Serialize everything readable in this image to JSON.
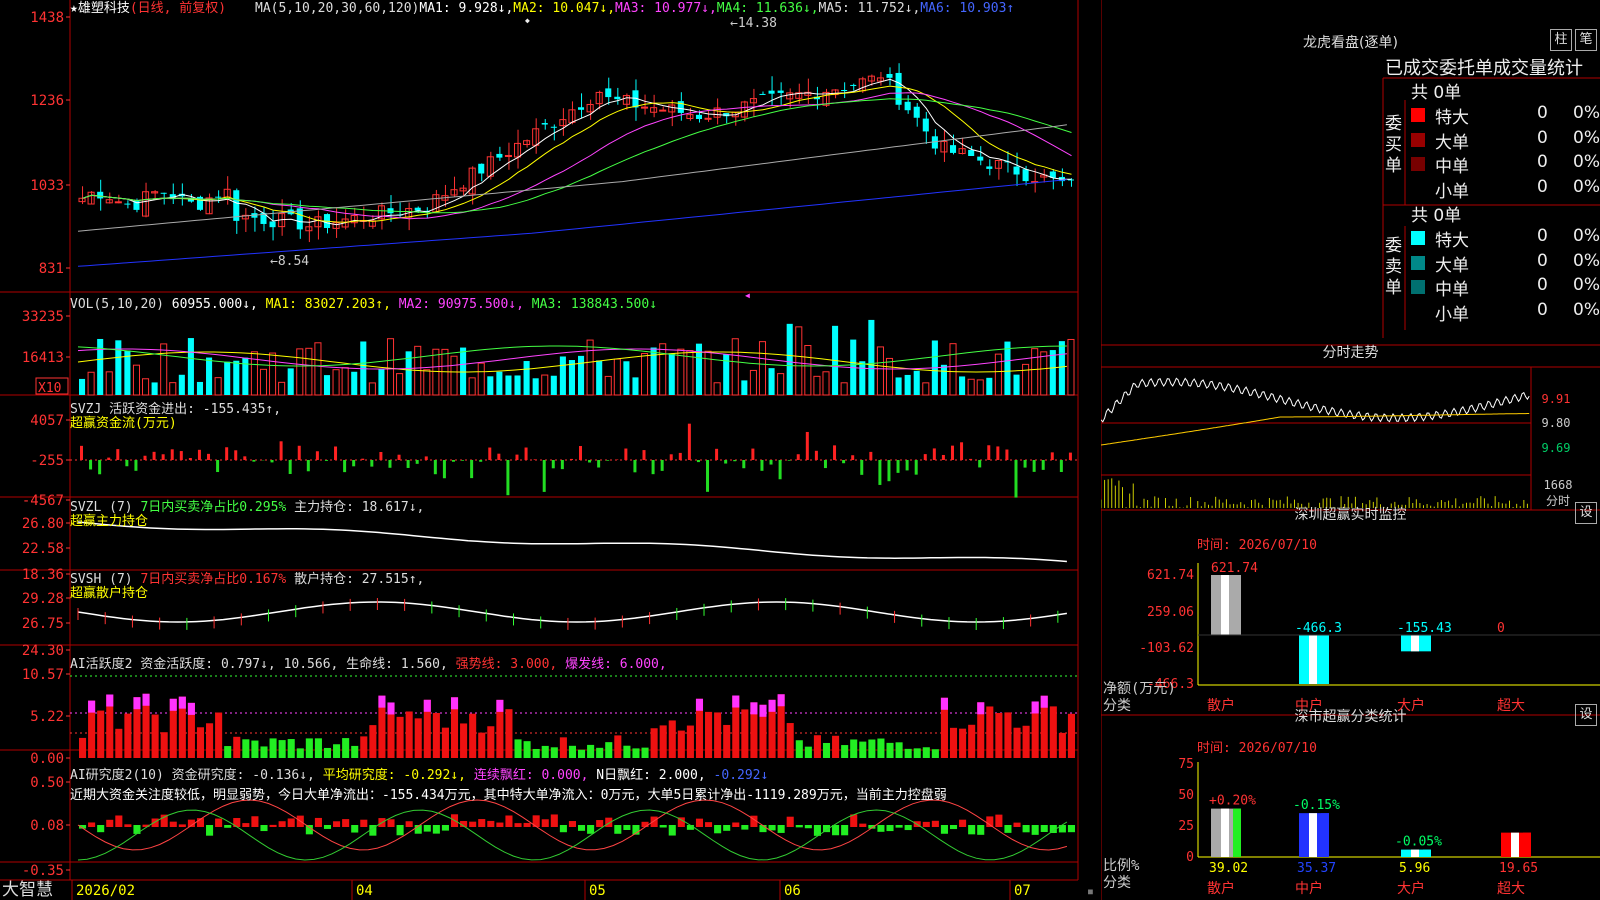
{
  "stock": {
    "name": "雄塑科技",
    "mode": "(日线, 前复权)",
    "ma_line": [
      {
        "label": "MA(5,10,20,30,60,120)",
        "color": "#dddddd"
      },
      {
        "label": "MA1: 9.928↓,",
        "color": "#ffffff"
      },
      {
        "label": "MA2: 10.047↓,",
        "color": "#ffff00"
      },
      {
        "label": "MA3: 10.977↓,",
        "color": "#ff44ff"
      },
      {
        "label": "MA4: 11.636↓,",
        "color": "#44ff44"
      },
      {
        "label": "MA5: 11.752↓,",
        "color": "#dddddd"
      },
      {
        "label": "MA6: 10.903↑",
        "color": "#4466ff"
      }
    ],
    "high_mark": "14.38",
    "low_mark": "8.54"
  },
  "axes": {
    "price": [
      "1438",
      "1236",
      "1033",
      "831"
    ],
    "vol": [
      "33235",
      "16413"
    ],
    "vol_unit": "X10",
    "svzj": [
      "4057",
      "-255",
      "-4567"
    ],
    "svzl": [
      "26.80",
      "22.58",
      "18.36"
    ],
    "svsh": [
      "29.28",
      "26.75",
      "24.30"
    ],
    "ai1": [
      "10.57",
      "5.22",
      "0.00"
    ],
    "ai2": [
      "0.50",
      "0.08",
      "-0.35"
    ],
    "dates": [
      "2026/02",
      "04",
      "05",
      "06",
      "07"
    ]
  },
  "indicators": {
    "vol": [
      {
        "label": "VOL(5,10,20)",
        "color": "#dddddd"
      },
      {
        "label": " 60955.000↓,",
        "color": "#ffffff"
      },
      {
        "label": " MA1: 83027.203↑,",
        "color": "#ffff00"
      },
      {
        "label": " MA2: 90975.500↓,",
        "color": "#ff44ff"
      },
      {
        "label": " MA3: 138843.500↓",
        "color": "#44ff44"
      }
    ],
    "svzj": [
      {
        "label": "SVZJ  活跃资金进出: -155.435↑,",
        "color": "#dddddd"
      }
    ],
    "svzj_sub": "超赢资金流(万元)",
    "svzl": [
      {
        "label": "SVZL (7) ",
        "color": "#dddddd"
      },
      {
        "label": "7日内买卖净占比0.295%",
        "color": "#44ff44"
      },
      {
        "label": " 主力持仓: 18.617↓,",
        "color": "#dddddd"
      }
    ],
    "svzl_sub": "超赢主力持仓",
    "svsh": [
      {
        "label": "SVSH (7) ",
        "color": "#dddddd"
      },
      {
        "label": "7日内买卖净占比0.167%",
        "color": "#ff3333"
      },
      {
        "label": " 散户持仓: 27.515↑,",
        "color": "#dddddd"
      }
    ],
    "svsh_sub": "超赢散户持仓",
    "ai1": [
      {
        "label": "AI活跃度2 资金活跃度: 0.797↓, 10.566, 生命线: 1.560, ",
        "color": "#dddddd"
      },
      {
        "label": "强势线: 3.000, ",
        "color": "#ff3333"
      },
      {
        "label": "爆发线: 6.000,",
        "color": "#ff44ff"
      }
    ],
    "ai2": [
      {
        "label": "AI研究度2(10) 资金研究度: -0.136↓, ",
        "color": "#dddddd"
      },
      {
        "label": "平均研究度: -0.292↓, ",
        "color": "#ffff00"
      },
      {
        "label": "连续飘红: 0.000, ",
        "color": "#ff44ff"
      },
      {
        "label": "N日飘红: 2.000, ",
        "color": "#ffffff"
      },
      {
        "label": "-0.292↓",
        "color": "#4466ff"
      }
    ],
    "ai2_text": "近期大资金关注度较低，明显弱势，今日大单净流出：-155.434万元，其中特大单净流入：0万元，大单5日累计净出-1119.289万元，当前主力控盘弱"
  },
  "brand": "大智慧",
  "dragon_tiger": {
    "title": "龙虎看盘(逐单)",
    "btn1": "柱",
    "btn2": "笔",
    "header": "已成交委托单成交量统计",
    "buy_label": "委买单",
    "sell_label": "委卖单",
    "buy_total": "共 0单",
    "sell_total": "共 0单",
    "buy_rows": [
      {
        "name": "特大",
        "count": "0",
        "pct": "0%",
        "color": "#ff0000"
      },
      {
        "name": "大单",
        "count": "0",
        "pct": "0%",
        "color": "#990000"
      },
      {
        "name": "中单",
        "count": "0",
        "pct": "0%",
        "color": "#770000"
      },
      {
        "name": "小单",
        "count": "0",
        "pct": "0%",
        "color": ""
      }
    ],
    "sell_rows": [
      {
        "name": "特大",
        "count": "0",
        "pct": "0%",
        "color": "#00ffff"
      },
      {
        "name": "大单",
        "count": "0",
        "pct": "0%",
        "color": "#008888"
      },
      {
        "name": "中单",
        "count": "0",
        "pct": "0%",
        "color": "#007070"
      },
      {
        "name": "小单",
        "count": "0",
        "pct": "0%",
        "color": ""
      }
    ]
  },
  "intraday": {
    "title": "分时走势",
    "prices": [
      "9.91",
      "9.80",
      "9.69"
    ],
    "vol_label": "1668",
    "unit_label": "分时"
  },
  "sz_monitor": {
    "title": "深圳超赢实时监控",
    "gear": "设",
    "time_label": "时间: 2026/07/10",
    "yticks": [
      "621.74",
      "259.06",
      "-103.62",
      "-466.3"
    ],
    "ylabel": "净额(万元)",
    "xlabel": "分类",
    "categories": [
      "散户",
      "中户",
      "大户",
      "超大"
    ]
  },
  "sz_class": {
    "title": "深市超赢分类统计",
    "gear": "设",
    "time_label": "时间: 2026/07/10",
    "yticks": [
      "75",
      "50",
      "25",
      "0"
    ],
    "ylabel": "比例%",
    "xlabel": "分类",
    "categories": [
      "散户",
      "中户",
      "大户",
      "超大"
    ]
  },
  "chart_data": [
    {
      "type": "bar",
      "title": "深圳超赢实时监控",
      "categories": [
        "散户",
        "中户",
        "大户",
        "超大"
      ],
      "values": [
        621.74,
        -466.3,
        -155.43,
        0
      ],
      "value_labels": [
        "621.74",
        "-466.3",
        "-155.43",
        "0"
      ],
      "ylabel": "净额(万元)",
      "xlabel": "分类",
      "ylim": [
        -466.3,
        621.74
      ]
    },
    {
      "type": "bar",
      "title": "深市超赢分类统计",
      "categories": [
        "散户",
        "中户",
        "大户",
        "超大"
      ],
      "series": [
        {
          "values": [
            39.02,
            35.37,
            5.96,
            19.65
          ]
        },
        {
          "values": [
            0.2,
            -0.15,
            -0.05,
            0
          ]
        }
      ],
      "value_labels": [
        "39.02",
        "35.37",
        "5.96",
        "19.65"
      ],
      "change_labels": [
        "+0.20%",
        "-0.15%",
        "-0.05%",
        ""
      ],
      "ylabel": "比例%",
      "xlabel": "分类",
      "ylim": [
        0,
        75
      ]
    }
  ]
}
